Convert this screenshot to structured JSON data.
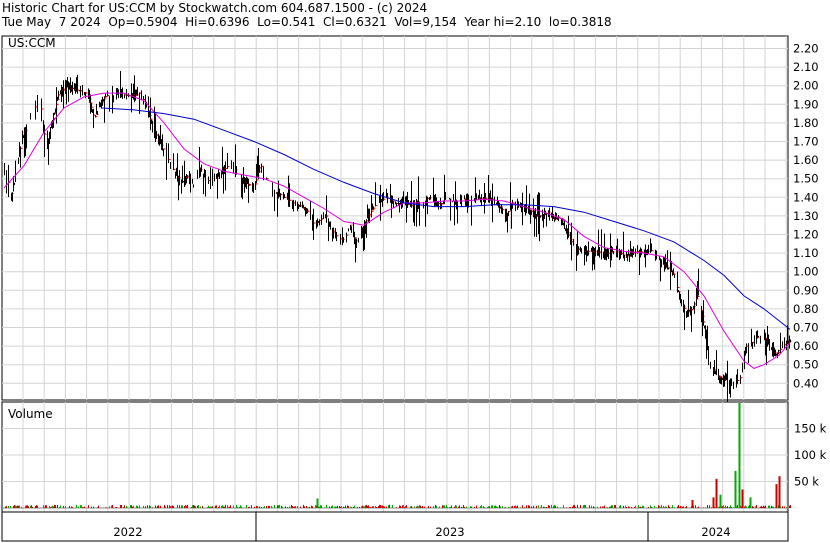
{
  "header": {
    "line1": "Historic Chart for US:CCM by Stockwatch.com 604.687.1500 - (c) 2024",
    "line2": "Tue May  7 2024  Op=0.5904  Hi=0.6396  Lo=0.541  Cl=0.6321  Vol=9,154  Year hi=2.10  lo=0.3818"
  },
  "chart_data": [
    {
      "type": "line",
      "panel": "price",
      "title": "US:CCM",
      "y_ticks": [
        "2.20",
        "2.10",
        "2.00",
        "1.90",
        "1.80",
        "1.70",
        "1.60",
        "1.50",
        "1.40",
        "1.30",
        "1.20",
        "1.10",
        "1.00",
        "0.90",
        "0.80",
        "0.70",
        "0.60",
        "0.50",
        "0.40"
      ],
      "ylim": [
        0.35,
        2.25
      ],
      "x_labels": [
        "2022",
        "2023",
        "2024"
      ],
      "grid": true,
      "colors": {
        "price_bar": "#000000",
        "close_tick": "#cc0000",
        "ma_short": "#e000e0",
        "ma_long": "#0000cc"
      },
      "close_anchors": [
        [
          0,
          1.58
        ],
        [
          4,
          1.48
        ],
        [
          8,
          1.4
        ],
        [
          12,
          1.55
        ],
        [
          18,
          1.72
        ],
        [
          24,
          1.8
        ],
        [
          30,
          1.88
        ],
        [
          36,
          1.92
        ],
        [
          42,
          1.65
        ],
        [
          48,
          1.8
        ],
        [
          54,
          1.95
        ],
        [
          62,
          2.0
        ],
        [
          70,
          1.98
        ],
        [
          78,
          1.97
        ],
        [
          84,
          1.95
        ],
        [
          90,
          1.82
        ],
        [
          96,
          1.9
        ],
        [
          102,
          1.95
        ],
        [
          108,
          1.93
        ],
        [
          114,
          1.97
        ],
        [
          120,
          1.95
        ],
        [
          128,
          1.94
        ],
        [
          135,
          1.96
        ],
        [
          142,
          1.9
        ],
        [
          148,
          1.78
        ],
        [
          155,
          1.7
        ],
        [
          160,
          1.65
        ],
        [
          166,
          1.58
        ],
        [
          172,
          1.52
        ],
        [
          178,
          1.48
        ],
        [
          184,
          1.52
        ],
        [
          190,
          1.45
        ],
        [
          196,
          1.55
        ],
        [
          202,
          1.5
        ],
        [
          208,
          1.47
        ],
        [
          214,
          1.52
        ],
        [
          220,
          1.55
        ],
        [
          226,
          1.58
        ],
        [
          232,
          1.54
        ],
        [
          238,
          1.5
        ],
        [
          244,
          1.47
        ],
        [
          250,
          1.45
        ],
        [
          256,
          1.58
        ],
        [
          262,
          1.5
        ],
        [
          268,
          1.44
        ],
        [
          274,
          1.42
        ],
        [
          280,
          1.4
        ],
        [
          286,
          1.38
        ],
        [
          292,
          1.36
        ],
        [
          298,
          1.35
        ],
        [
          304,
          1.32
        ],
        [
          310,
          1.25
        ],
        [
          316,
          1.28
        ],
        [
          322,
          1.3
        ],
        [
          328,
          1.22
        ],
        [
          334,
          1.18
        ],
        [
          340,
          1.17
        ],
        [
          346,
          1.25
        ],
        [
          352,
          1.15
        ],
        [
          358,
          1.22
        ],
        [
          364,
          1.3
        ],
        [
          370,
          1.35
        ],
        [
          376,
          1.38
        ],
        [
          382,
          1.4
        ],
        [
          388,
          1.38
        ],
        [
          394,
          1.36
        ],
        [
          400,
          1.38
        ],
        [
          406,
          1.35
        ],
        [
          412,
          1.38
        ],
        [
          418,
          1.36
        ],
        [
          424,
          1.4
        ],
        [
          430,
          1.38
        ],
        [
          436,
          1.36
        ],
        [
          442,
          1.4
        ],
        [
          448,
          1.38
        ],
        [
          454,
          1.37
        ],
        [
          460,
          1.39
        ],
        [
          466,
          1.38
        ],
        [
          472,
          1.4
        ],
        [
          478,
          1.39
        ],
        [
          484,
          1.4
        ],
        [
          490,
          1.38
        ],
        [
          496,
          1.35
        ],
        [
          502,
          1.3
        ],
        [
          508,
          1.37
        ],
        [
          514,
          1.35
        ],
        [
          520,
          1.34
        ],
        [
          526,
          1.33
        ],
        [
          532,
          1.3
        ],
        [
          538,
          1.3
        ],
        [
          544,
          1.32
        ],
        [
          550,
          1.28
        ],
        [
          556,
          1.3
        ],
        [
          562,
          1.22
        ],
        [
          568,
          1.15
        ],
        [
          574,
          1.12
        ],
        [
          580,
          1.11
        ],
        [
          586,
          1.11
        ],
        [
          592,
          1.11
        ],
        [
          598,
          1.1
        ],
        [
          604,
          1.1
        ],
        [
          610,
          1.11
        ],
        [
          616,
          1.1
        ],
        [
          622,
          1.08
        ],
        [
          628,
          1.1
        ],
        [
          634,
          1.11
        ],
        [
          640,
          1.1
        ],
        [
          646,
          1.12
        ],
        [
          652,
          1.08
        ],
        [
          658,
          1.05
        ],
        [
          664,
          1.02
        ],
        [
          670,
          0.98
        ],
        [
          676,
          0.85
        ],
        [
          682,
          0.78
        ],
        [
          688,
          0.8
        ],
        [
          694,
          0.88
        ],
        [
          700,
          0.7
        ],
        [
          706,
          0.5
        ],
        [
          712,
          0.45
        ],
        [
          718,
          0.42
        ],
        [
          724,
          0.42
        ],
        [
          730,
          0.4
        ],
        [
          736,
          0.43
        ],
        [
          742,
          0.6
        ],
        [
          748,
          0.62
        ],
        [
          754,
          0.65
        ],
        [
          760,
          0.65
        ],
        [
          766,
          0.6
        ],
        [
          772,
          0.55
        ],
        [
          778,
          0.6
        ],
        [
          786,
          0.63
        ]
      ],
      "ma_short": [
        [
          0,
          1.45
        ],
        [
          20,
          1.57
        ],
        [
          40,
          1.75
        ],
        [
          60,
          1.88
        ],
        [
          80,
          1.94
        ],
        [
          100,
          1.96
        ],
        [
          120,
          1.96
        ],
        [
          140,
          1.92
        ],
        [
          160,
          1.8
        ],
        [
          180,
          1.66
        ],
        [
          200,
          1.58
        ],
        [
          220,
          1.54
        ],
        [
          240,
          1.52
        ],
        [
          260,
          1.5
        ],
        [
          280,
          1.46
        ],
        [
          300,
          1.4
        ],
        [
          320,
          1.34
        ],
        [
          340,
          1.27
        ],
        [
          360,
          1.25
        ],
        [
          380,
          1.32
        ],
        [
          400,
          1.37
        ],
        [
          420,
          1.37
        ],
        [
          440,
          1.38
        ],
        [
          460,
          1.38
        ],
        [
          480,
          1.39
        ],
        [
          500,
          1.38
        ],
        [
          520,
          1.35
        ],
        [
          540,
          1.32
        ],
        [
          560,
          1.28
        ],
        [
          580,
          1.19
        ],
        [
          600,
          1.13
        ],
        [
          620,
          1.11
        ],
        [
          640,
          1.1
        ],
        [
          660,
          1.08
        ],
        [
          680,
          1.0
        ],
        [
          700,
          0.87
        ],
        [
          720,
          0.68
        ],
        [
          740,
          0.52
        ],
        [
          750,
          0.48
        ],
        [
          760,
          0.5
        ],
        [
          775,
          0.55
        ],
        [
          786,
          0.62
        ]
      ],
      "ma_long": [
        [
          98,
          1.88
        ],
        [
          130,
          1.87
        ],
        [
          160,
          1.85
        ],
        [
          190,
          1.82
        ],
        [
          220,
          1.76
        ],
        [
          250,
          1.7
        ],
        [
          280,
          1.63
        ],
        [
          310,
          1.55
        ],
        [
          340,
          1.48
        ],
        [
          370,
          1.42
        ],
        [
          400,
          1.37
        ],
        [
          430,
          1.35
        ],
        [
          460,
          1.35
        ],
        [
          490,
          1.36
        ],
        [
          520,
          1.36
        ],
        [
          550,
          1.35
        ],
        [
          580,
          1.32
        ],
        [
          610,
          1.27
        ],
        [
          640,
          1.22
        ],
        [
          670,
          1.16
        ],
        [
          700,
          1.06
        ],
        [
          720,
          0.98
        ],
        [
          740,
          0.87
        ],
        [
          760,
          0.8
        ],
        [
          786,
          0.69
        ]
      ]
    },
    {
      "type": "bar",
      "panel": "volume",
      "title": "Volume",
      "y_ticks": [
        "150 k",
        "100 k",
        "50 k"
      ],
      "ylim": [
        0,
        200000
      ],
      "colors": {
        "up": "#00aa00",
        "down": "#cc0000"
      },
      "spikes": [
        {
          "x": 713,
          "value": 20000,
          "dir": "down"
        },
        {
          "x": 716,
          "value": 55000,
          "dir": "down"
        },
        {
          "x": 720,
          "value": 25000,
          "dir": "up"
        },
        {
          "x": 735,
          "value": 70000,
          "dir": "up"
        },
        {
          "x": 739,
          "value": 205000,
          "dir": "up"
        },
        {
          "x": 742,
          "value": 35000,
          "dir": "down"
        },
        {
          "x": 750,
          "value": 20000,
          "dir": "up"
        },
        {
          "x": 776,
          "value": 45000,
          "dir": "down"
        },
        {
          "x": 779,
          "value": 60000,
          "dir": "down"
        },
        {
          "x": 317,
          "value": 18000,
          "dir": "up"
        },
        {
          "x": 692,
          "value": 15000,
          "dir": "down"
        }
      ]
    }
  ]
}
